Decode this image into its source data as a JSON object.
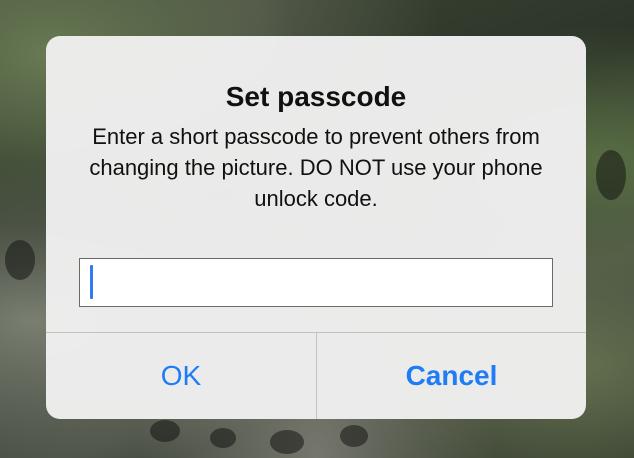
{
  "dialog": {
    "title": "Set passcode",
    "message": "Enter a short passcode to prevent others from changing the picture. DO NOT use your phone unlock code.",
    "input_value": "",
    "ok_label": "OK",
    "cancel_label": "Cancel"
  },
  "colors": {
    "accent": "#1f7cf4",
    "dialog_background": "#f0f0f0",
    "text": "#111111"
  }
}
